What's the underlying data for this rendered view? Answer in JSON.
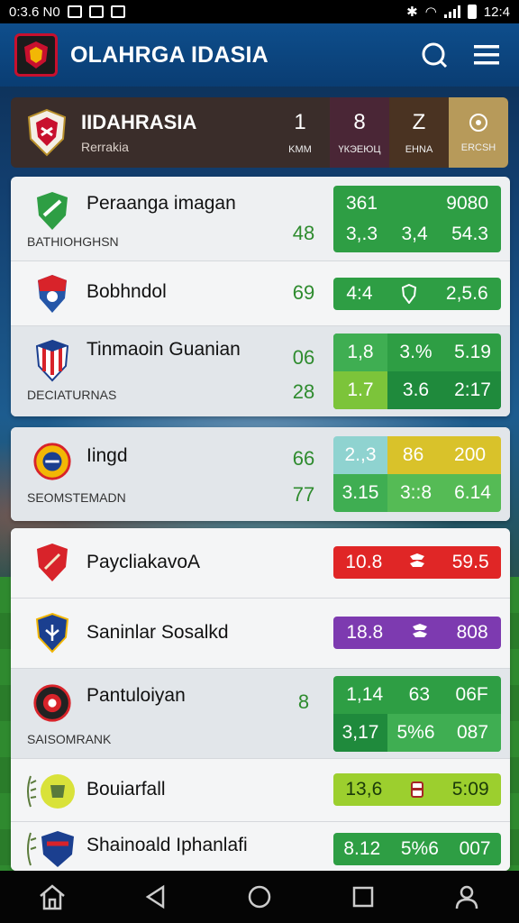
{
  "status_bar": {
    "time_left": "0:3.6 N0",
    "time_right": "12:4"
  },
  "header": {
    "title": "OLAHRGA IDASIA"
  },
  "league": {
    "name": "IIDAHRASIA",
    "subtitle": "Rerrakia",
    "stats": [
      {
        "value": "1",
        "label": "KMM",
        "color": "#3a2d2a"
      },
      {
        "value": "8",
        "label": "ҮКЭЕЮЦ",
        "color": "#4a2636"
      },
      {
        "value": "Z",
        "label": "EHNA",
        "color": "#4a3322"
      },
      {
        "value": "",
        "label": "ERCSH",
        "color": "#b79a5a"
      }
    ]
  },
  "cards": [
    {
      "rows": [
        {
          "team": "Peraanga imagan",
          "sub": "BATHIOHGHSN",
          "score": "48",
          "odds_top": [
            "361",
            "9080"
          ],
          "odds": [
            "3,.3",
            "3,4",
            "54.3"
          ],
          "color": "#2e9e44"
        },
        {
          "team": "Bobhndol",
          "score": "69",
          "odds": [
            "4:4",
            "",
            "2,5.6"
          ],
          "color": "#2e9e44",
          "icon": "shield-outline-icon"
        },
        {
          "team": "Tinmaoin Guanian",
          "sub": "DECIATURNAS",
          "score_top": "06",
          "score": "28",
          "odds_top": [
            "1,8",
            "3.%",
            "5.19"
          ],
          "odds": [
            "1.7",
            "3.6",
            "2:17"
          ],
          "color": "#2e9e44"
        }
      ]
    },
    {
      "rows": [
        {
          "team": "Iingd",
          "sub": "SEOMSTEMADN",
          "score_top": "66",
          "score": "77",
          "odds_top": [
            "2.,3",
            "86",
            "200"
          ],
          "odds": [
            "3.15",
            "3::8",
            "6.14"
          ]
        }
      ]
    },
    {
      "rows": [
        {
          "team": "PaycliakavoA",
          "odds": [
            "10.8",
            "",
            "59.5"
          ],
          "color": "#e02626",
          "icon": "stacked-shirt-icon"
        },
        {
          "team": "Saninlar Sosalkd",
          "odds": [
            "18.8",
            "",
            "808"
          ],
          "color": "#7d3ab0",
          "icon": "stacked-shirt-icon"
        },
        {
          "team": "Pantuloiyan",
          "sub": "SAISOMRANK",
          "score": "8",
          "odds_top": [
            "1,14",
            "63",
            "06F"
          ],
          "odds": [
            "3,17",
            "5%6",
            "087"
          ],
          "color": "#2e9e44"
        },
        {
          "team": "Bouiarfall",
          "odds": [
            "13,6",
            "",
            "5:09"
          ],
          "color": "#9ccf2e",
          "icon": "jersey-icon"
        },
        {
          "team": "Shainoald Iphanlafi",
          "odds": [
            "8.12",
            "5%6",
            "007"
          ],
          "color": "#2e9e44"
        }
      ]
    }
  ],
  "colors": {
    "header": "#0e4e8c",
    "green": "#2e9e44",
    "red": "#e02626",
    "purple": "#7d3ab0",
    "lime": "#9ccf2e",
    "teal": "#8fd3d0",
    "yellow": "#d9c22a"
  }
}
